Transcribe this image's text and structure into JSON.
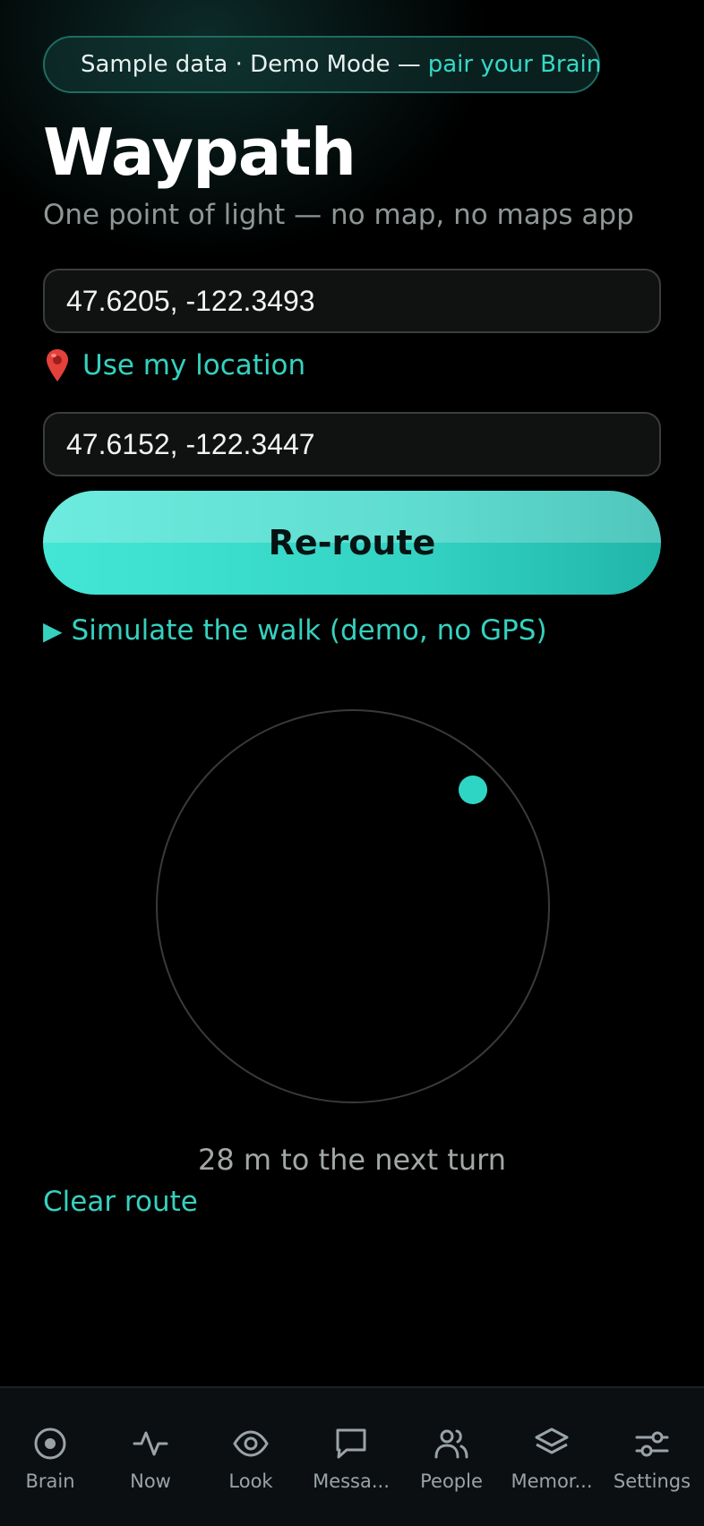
{
  "banner": {
    "text": "Sample data · Demo Mode —",
    "link": "pair your Brain"
  },
  "header": {
    "title": "Waypath",
    "subtitle": "One point of light — no map, no maps app"
  },
  "route": {
    "from_value": "47.6205, -122.3493",
    "use_location_label": "Use my location",
    "to_value": "47.6152, -122.3447",
    "reroute_label": "Re-route",
    "simulate_label": "Simulate the walk (demo, no GPS)",
    "distance_text": "28 m to the next turn",
    "clear_label": "Clear route"
  },
  "tabs": [
    {
      "label": "Brain",
      "icon": "brain-icon"
    },
    {
      "label": "Now",
      "icon": "activity-icon"
    },
    {
      "label": "Look",
      "icon": "eye-icon"
    },
    {
      "label": "Messa...",
      "icon": "message-icon"
    },
    {
      "label": "People",
      "icon": "people-icon"
    },
    {
      "label": "Memor...",
      "icon": "layers-icon"
    },
    {
      "label": "Settings",
      "icon": "sliders-icon"
    }
  ],
  "colors": {
    "accent": "#35d1bf",
    "background": "#000000",
    "tabbar": "#0c0f11"
  }
}
